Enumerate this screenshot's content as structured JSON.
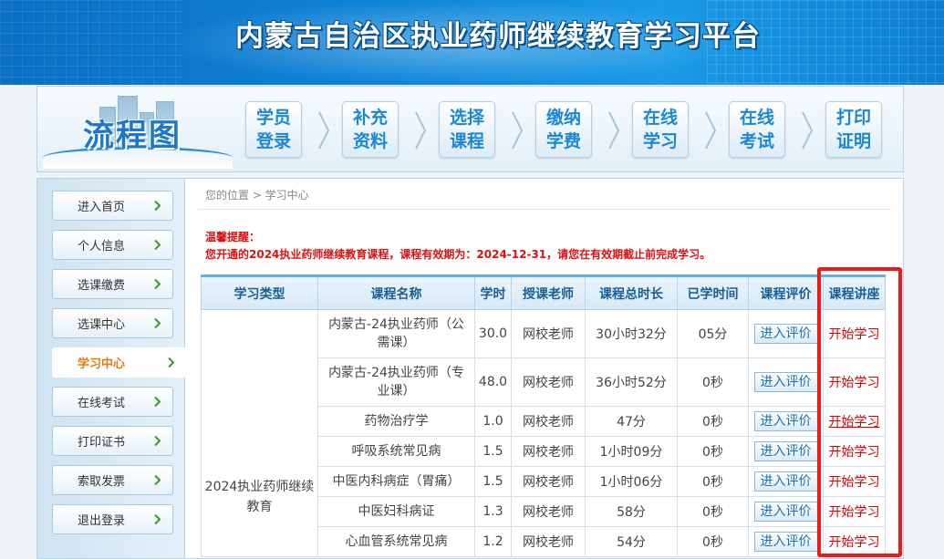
{
  "header": {
    "title": "内蒙古自治区执业药师继续教育学习平台"
  },
  "flow": {
    "title": "流程图",
    "steps": [
      {
        "line1": "学员",
        "line2": "登录"
      },
      {
        "line1": "补充",
        "line2": "资料"
      },
      {
        "line1": "选择",
        "line2": "课程"
      },
      {
        "line1": "缴纳",
        "line2": "学费"
      },
      {
        "line1": "在线",
        "line2": "学习"
      },
      {
        "line1": "在线",
        "line2": "考试"
      },
      {
        "line1": "打印",
        "line2": "证明"
      }
    ]
  },
  "sidebar": {
    "items": [
      {
        "label": "进入首页"
      },
      {
        "label": "个人信息"
      },
      {
        "label": "选课缴费"
      },
      {
        "label": "选课中心"
      },
      {
        "label": "学习中心",
        "active": true
      },
      {
        "label": "在线考试"
      },
      {
        "label": "打印证书"
      },
      {
        "label": "索取发票"
      },
      {
        "label": "退出登录"
      }
    ]
  },
  "breadcrumb": {
    "text": "您的位置 > 学习中心"
  },
  "notice": {
    "title": "温馨提醒：",
    "text": "您开通的2024执业药师继续教育课程，课程有效期为：2024-12-31，请您在有效期截止前完成学习。"
  },
  "table": {
    "headers": [
      "学习类型",
      "课程名称",
      "学时",
      "授课老师",
      "课程总时长",
      "已学时间",
      "课程评价",
      "课程讲座"
    ],
    "study_type": "2024执业药师继续教育",
    "rows": [
      {
        "name": "内蒙古-24执业药师（公需课）",
        "hours": "30.0",
        "teacher": "网校老师",
        "total": "30小时32分",
        "studied": "05分",
        "eval": "进入评价",
        "action": "开始学习"
      },
      {
        "name": "内蒙古-24执业药师（专业课）",
        "hours": "48.0",
        "teacher": "网校老师",
        "total": "36小时52分",
        "studied": "0秒",
        "eval": "进入评价",
        "action": "开始学习"
      },
      {
        "name": "药物治疗学",
        "hours": "1.0",
        "teacher": "网校老师",
        "total": "47分",
        "studied": "0秒",
        "eval": "进入评价",
        "action": "开始学习"
      },
      {
        "name": "呼吸系统常见病",
        "hours": "1.5",
        "teacher": "网校老师",
        "total": "1小时09分",
        "studied": "0秒",
        "eval": "进入评价",
        "action": "开始学习"
      },
      {
        "name": "中医内科病症（胃痛）",
        "hours": "1.5",
        "teacher": "网校老师",
        "total": "1小时06分",
        "studied": "0秒",
        "eval": "进入评价",
        "action": "开始学习"
      },
      {
        "name": "中医妇科病证",
        "hours": "1.3",
        "teacher": "网校老师",
        "total": "58分",
        "studied": "0秒",
        "eval": "进入评价",
        "action": "开始学习"
      },
      {
        "name": "心血管系统常见病",
        "hours": "1.2",
        "teacher": "网校老师",
        "total": "54分",
        "studied": "0秒",
        "eval": "进入评价",
        "action": "开始学习"
      }
    ]
  },
  "colors": {
    "accent": "#1b87d6",
    "warning": "#dd1111",
    "highlight": "#ee1a1a",
    "active_nav": "#e07c12"
  },
  "icons": {
    "nav_arrow": "chevron-right-icon",
    "flow_separator": "chevron-right-icon"
  }
}
